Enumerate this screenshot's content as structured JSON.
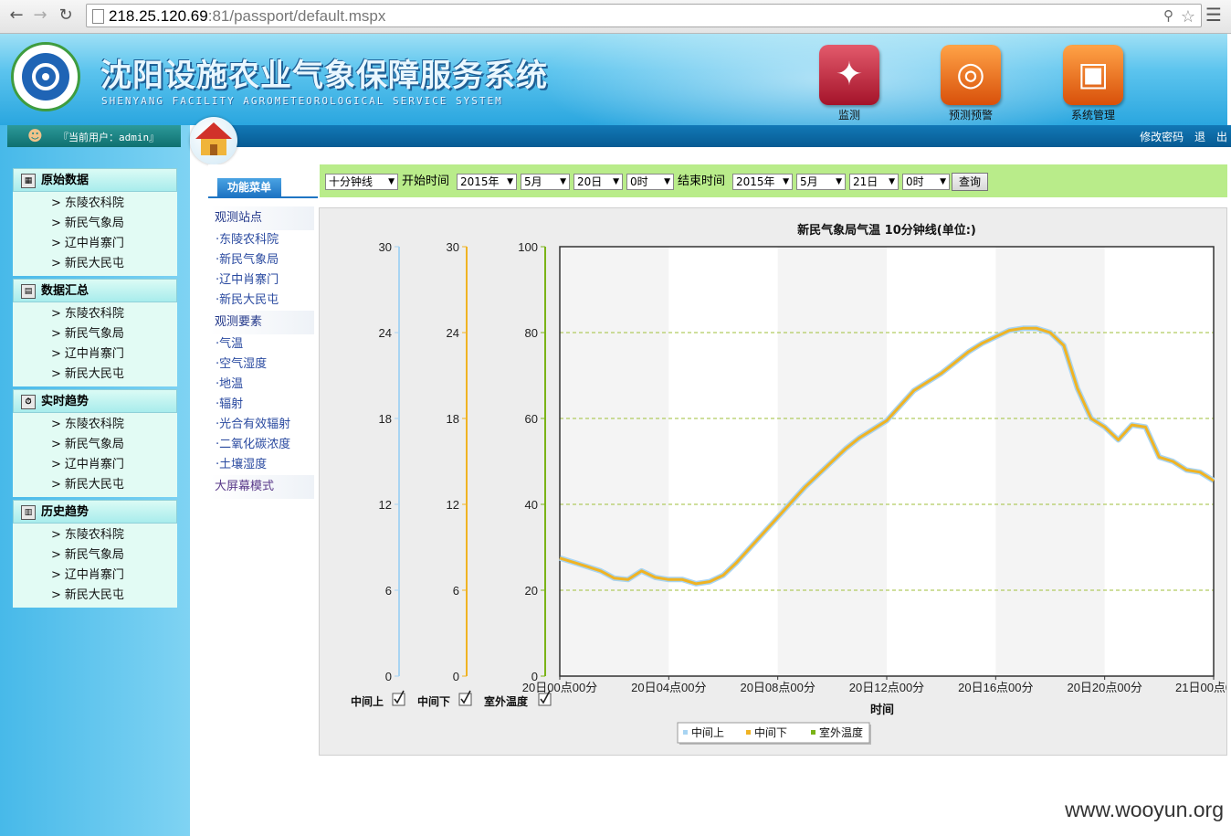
{
  "browser": {
    "url_host": "218.25.120.69",
    "url_rest": ":81/passport/default.mspx"
  },
  "header": {
    "title": "沈阳设施农业气象保障服务系统",
    "subtitle": "SHENYANG FACILITY AGROMETEOROLOGICAL SERVICE SYSTEM",
    "buttons": [
      {
        "label": "监测"
      },
      {
        "label": "预测预警"
      },
      {
        "label": "系统管理"
      }
    ]
  },
  "userbar": {
    "current_user": "『当前用户：admin』"
  },
  "topnav": {
    "change_password": "修改密码",
    "logout": "退　出"
  },
  "sidebar": {
    "sections": [
      {
        "title": "原始数据",
        "items": [
          "东陵农科院",
          "新民气象局",
          "辽中肖寨门",
          "新民大民屯"
        ]
      },
      {
        "title": "数据汇总",
        "items": [
          "东陵农科院",
          "新民气象局",
          "辽中肖寨门",
          "新民大民屯"
        ]
      },
      {
        "title": "实时趋势",
        "items": [
          "东陵农科院",
          "新民气象局",
          "辽中肖寨门",
          "新民大民屯"
        ]
      },
      {
        "title": "历史趋势",
        "items": [
          "东陵农科院",
          "新民气象局",
          "辽中肖寨门",
          "新民大民屯"
        ]
      }
    ],
    "arrow": ">"
  },
  "func_menu": {
    "tab": "功能菜单",
    "stations_head": "观测站点",
    "stations": [
      "·东陵农科院",
      "·新民气象局",
      "·辽中肖寨门",
      "·新民大民屯"
    ],
    "elements_head": "观测要素",
    "elements": [
      "·气温",
      "·空气湿度",
      "·地温",
      "·辐射",
      "·光合有效辐射",
      "·二氧化碳浓度",
      "·土壤湿度"
    ],
    "bigscreen": "大屏幕模式"
  },
  "filter": {
    "interval": "十分钟线",
    "start_label": "开始时间",
    "start_year": "2015年",
    "start_month": "5月",
    "start_day": "20日",
    "start_hour": "0时",
    "end_label": "结束时间",
    "end_year": "2015年",
    "end_month": "5月",
    "end_day": "21日",
    "end_hour": "0时",
    "query": "查询"
  },
  "colors": {
    "series1": "#a8d4f2",
    "series2": "#f0b323",
    "series3": "#7ab317"
  },
  "chart_data": {
    "type": "line",
    "title": "新民气象局气温 10分钟线(单位:)",
    "xlabel": "时间",
    "x_tick_labels": [
      "20日00点00分",
      "20日04点00分",
      "20日08点00分",
      "20日12点00分",
      "20日16点00分",
      "20日20点00分",
      "21日00点00分"
    ],
    "x_range_hours": [
      0,
      24
    ],
    "axes": [
      {
        "name": "中间上",
        "ticks": [
          "0",
          "6",
          "12",
          "18",
          "24",
          "30"
        ],
        "ylim": [
          0,
          30
        ]
      },
      {
        "name": "中间下",
        "ticks": [
          "0",
          "6",
          "12",
          "18",
          "24",
          "30"
        ],
        "ylim": [
          0,
          30
        ]
      },
      {
        "name": "室外温度",
        "ticks": [
          "0",
          "20",
          "40",
          "60",
          "80",
          "100"
        ],
        "ylim": [
          0,
          100
        ]
      }
    ],
    "grid": true,
    "legend_position": "bottom",
    "checkbox_labels": [
      "中间上",
      "中间下",
      "室外温度"
    ],
    "series": [
      {
        "name": "中间上",
        "x_hours": [
          0,
          0.5,
          1,
          1.5,
          2,
          2.5,
          3,
          3.5,
          4,
          4.5,
          5,
          5.5,
          6,
          6.5,
          7,
          7.5,
          8,
          8.5,
          9,
          9.5,
          10,
          10.5,
          11,
          11.5,
          12,
          12.5,
          13,
          13.5,
          14,
          14.5,
          15,
          15.5,
          16,
          16.5,
          17,
          17.5,
          18,
          18.5,
          19,
          19.5,
          20,
          20.5,
          21,
          21.5,
          22,
          22.5,
          23,
          23.5,
          24
        ],
        "values": [
          27.5,
          26.5,
          25.5,
          24.5,
          22.8,
          22.5,
          24.5,
          23,
          22.5,
          22.5,
          21.5,
          22,
          23.5,
          26.5,
          30,
          33.5,
          37,
          40.5,
          44,
          47,
          50,
          53,
          55.5,
          57.5,
          59.5,
          63,
          66.5,
          68.5,
          70.5,
          73,
          75.5,
          77.5,
          79,
          80.5,
          81,
          81,
          80,
          77,
          67,
          60,
          58,
          55,
          58.5,
          58,
          51,
          50,
          48,
          47.5,
          45.5
        ]
      },
      {
        "name": "中间下",
        "x_hours": [
          0,
          0.5,
          1,
          1.5,
          2,
          2.5,
          3,
          3.5,
          4,
          4.5,
          5,
          5.5,
          6,
          6.5,
          7,
          7.5,
          8,
          8.5,
          9,
          9.5,
          10,
          10.5,
          11,
          11.5,
          12,
          12.5,
          13,
          13.5,
          14,
          14.5,
          15,
          15.5,
          16,
          16.5,
          17,
          17.5,
          18,
          18.5,
          19,
          19.5,
          20,
          20.5,
          21,
          21.5,
          22,
          22.5,
          23,
          23.5,
          24
        ],
        "values": [
          27.5,
          26.5,
          25.5,
          24.5,
          22.8,
          22.5,
          24.5,
          23,
          22.5,
          22.5,
          21.5,
          22,
          23.5,
          26.5,
          30,
          33.5,
          37,
          40.5,
          44,
          47,
          50,
          53,
          55.5,
          57.5,
          59.5,
          63,
          66.5,
          68.5,
          70.5,
          73,
          75.5,
          77.5,
          79,
          80.5,
          81,
          81,
          80,
          77,
          67,
          60,
          58,
          55,
          58.5,
          58,
          51,
          50,
          48,
          47.5,
          45.5
        ]
      },
      {
        "name": "室外温度",
        "x_hours": [],
        "values": []
      }
    ],
    "legend": [
      "中间上",
      "中间下",
      "室外温度"
    ]
  },
  "watermark": "www.wooyun.org"
}
